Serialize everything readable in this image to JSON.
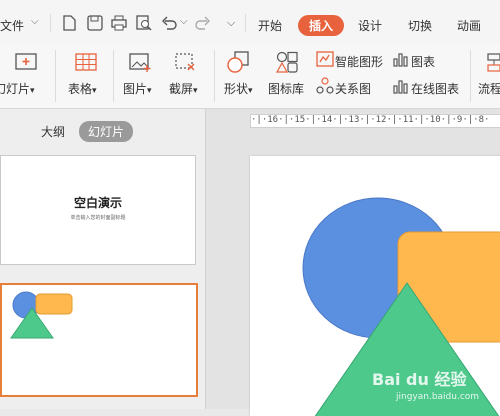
{
  "titlebar": {
    "file_label": "文件",
    "tabs": [
      {
        "label": "开始"
      },
      {
        "label": "插入"
      },
      {
        "label": "设计"
      },
      {
        "label": "切换"
      },
      {
        "label": "动画"
      }
    ],
    "active_tab": "插入"
  },
  "ribbon": {
    "slide": "幻灯片",
    "table": "表格",
    "picture": "图片",
    "screenshot": "截屏",
    "shape": "形状",
    "iconlib": "图标库",
    "smartart": "智能图形",
    "chart": "图表",
    "relation": "关系图",
    "online_chart": "在线图表",
    "flowchart": "流程"
  },
  "pane": {
    "tab_outline": "大纲",
    "tab_slides": "幻灯片",
    "slide1_title": "空白演示",
    "slide1_subtitle": "单击输入您的封面副标题"
  },
  "ruler": {
    "text": "·|·16·|·15·|·14·|·13·|·12·|·11·|·10·|·9·|·8·"
  },
  "colors": {
    "accent": "#e8623d",
    "circle": "#5b8fdf",
    "rect": "#ffb84e",
    "triangle": "#4dc98c",
    "selection": "#e67e3c"
  },
  "watermark": {
    "text": "Bai du 经验",
    "url": "jingyan.baidu.com"
  }
}
